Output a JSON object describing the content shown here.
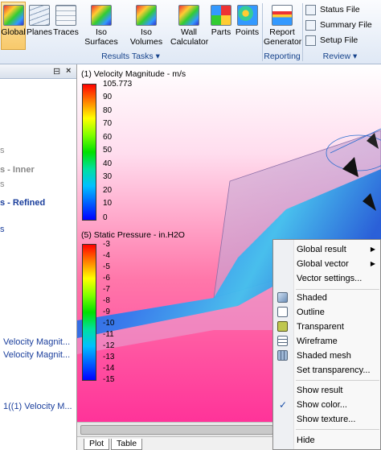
{
  "ribbon": {
    "buttons": [
      {
        "label": "Global",
        "icon": "global-icon"
      },
      {
        "label": "Planes",
        "icon": "planes-icon"
      },
      {
        "label": "Traces",
        "icon": "traces-icon"
      },
      {
        "label": "Iso Surfaces",
        "icon": "iso-surfaces-icon"
      },
      {
        "label": "Iso Volumes",
        "icon": "iso-volumes-icon"
      },
      {
        "label": "Wall Calculator",
        "icon": "wall-calculator-icon"
      },
      {
        "label": "Parts",
        "icon": "parts-icon"
      },
      {
        "label": "Points",
        "icon": "points-icon"
      }
    ],
    "report_button": {
      "label": "Report Generator",
      "icon": "report-generator-icon"
    },
    "review_items": [
      {
        "label": "Status File",
        "icon": "status-file-icon"
      },
      {
        "label": "Summary File",
        "icon": "summary-file-icon"
      },
      {
        "label": "Setup File",
        "icon": "setup-file-icon"
      }
    ],
    "groups": {
      "results_tasks": "Results Tasks",
      "reporting": "Reporting",
      "review": "Review"
    }
  },
  "left_panel": {
    "items": [
      {
        "text": "s"
      },
      {
        "text": "s - Inner"
      },
      {
        "text": "s"
      },
      {
        "text": "s - Refined"
      },
      {
        "text": "s"
      },
      {
        "text": "Velocity Magnit..."
      },
      {
        "text": "Velocity Magnit..."
      },
      {
        "text": "1((1) Velocity M..."
      }
    ]
  },
  "viewport": {
    "legend_velocity": {
      "title": "(1) Velocity Magnitude - m/s",
      "ticks": [
        "105.773",
        "90",
        "80",
        "70",
        "60",
        "50",
        "40",
        "30",
        "20",
        "10",
        "0"
      ]
    },
    "legend_pressure": {
      "title": "(5) Static Pressure - in.H2O",
      "ticks": [
        "-3",
        "-4",
        "-5",
        "-6",
        "-7",
        "-8",
        "-9",
        "-10",
        "-11",
        "-12",
        "-13",
        "-14",
        "-15"
      ]
    }
  },
  "tabs": [
    "Plot",
    "Table"
  ],
  "context_menu": {
    "items": [
      {
        "label": "Global result",
        "submenu": true
      },
      {
        "label": "Global vector",
        "submenu": true
      },
      {
        "label": "Vector settings..."
      },
      {
        "label": "Shaded",
        "icon": "shaded-icon"
      },
      {
        "label": "Outline",
        "icon": "outline-icon"
      },
      {
        "label": "Transparent",
        "icon": "transparent-icon"
      },
      {
        "label": "Wireframe",
        "icon": "wireframe-icon"
      },
      {
        "label": "Shaded mesh",
        "icon": "shaded-mesh-icon"
      },
      {
        "label": "Set transparency..."
      },
      {
        "label": "Show result"
      },
      {
        "label": "Show color...",
        "checked": true
      },
      {
        "label": "Show texture..."
      },
      {
        "label": "Hide"
      }
    ],
    "highlight_color": "#f3f03a"
  }
}
